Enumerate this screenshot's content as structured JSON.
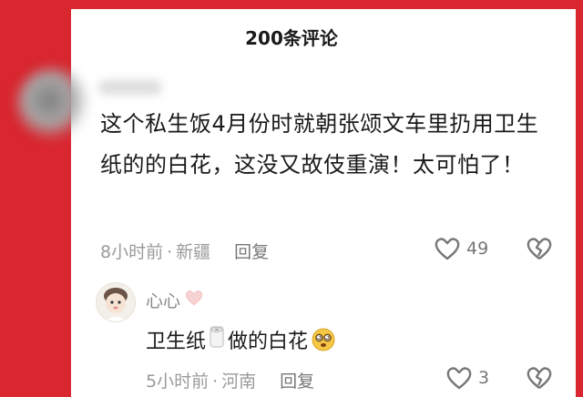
{
  "header": {
    "title": "200条评论"
  },
  "comment": {
    "text": "这个私生饭4月份时就朝张颂文车里扔用卫生纸的的白花，这没又故伎重演！太可怕了！",
    "time": "8小时前",
    "location": "新疆",
    "reply_label": "回复",
    "like_count": "49"
  },
  "reply": {
    "user_name": "心心",
    "text_before": "卫生纸",
    "text_after": "做的白花",
    "time": "5小时前",
    "location": "河南",
    "reply_label": "回复",
    "like_count": "3"
  },
  "colors": {
    "frame": "#d9262f",
    "meta": "#9a9a9a",
    "text": "#1a1a1a"
  },
  "icons": [
    "heart-outline-icon",
    "broken-heart-icon",
    "pink-heart-icon",
    "toilet-paper-icon",
    "dizzy-face-icon"
  ]
}
